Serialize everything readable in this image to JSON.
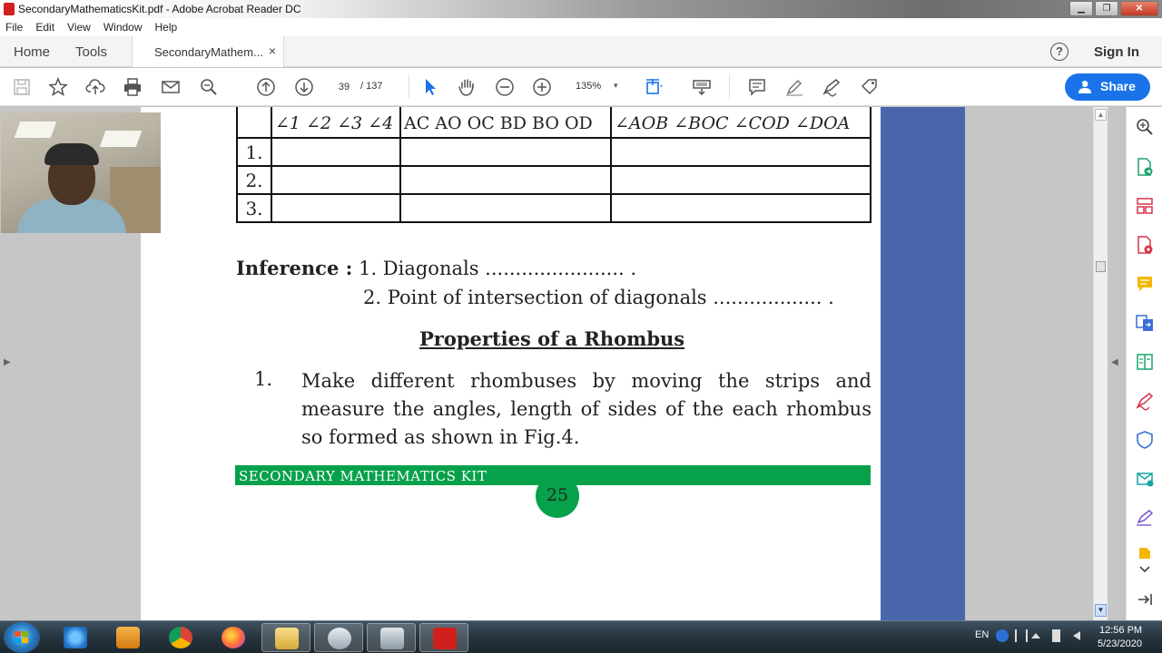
{
  "window": {
    "title": "SecondaryMathematicsKit.pdf - Adobe Acrobat Reader DC",
    "minimize": "▁",
    "maximize": "❐",
    "close": "✕"
  },
  "menu": [
    "File",
    "Edit",
    "View",
    "Window",
    "Help"
  ],
  "tabs": {
    "home": "Home",
    "tools": "Tools",
    "document": "SecondaryMathem...",
    "close": "×"
  },
  "header": {
    "help": "?",
    "sign_in": "Sign In"
  },
  "toolbar": {
    "page_current": "39",
    "page_total": "/ 137",
    "zoom": "135%",
    "zoom_caret": "▾",
    "share": "Share"
  },
  "pdf": {
    "table": {
      "header": {
        "angles": "∠1  ∠2  ∠3  ∠4",
        "lengths": "AC  AO  OC  BD BO  OD",
        "central_angles": "∠AOB  ∠BOC  ∠COD  ∠DOA"
      },
      "rows": [
        "1.",
        "2.",
        "3."
      ]
    },
    "inference_label": "Inference :",
    "inference_1": "1. Diagonals ....................... .",
    "inference_2": "2. Point of intersection of diagonals .................. .",
    "section_title": "Properties of a Rhombus",
    "list_number": "1.",
    "list_text": "Make different rhombuses by moving the strips and measure the angles, length of sides of the each rhombus so formed as shown in Fig.4.",
    "footer": "SECONDARY  MATHEMATICS  KIT",
    "page_number": "25"
  },
  "taskbar": {
    "lang": "EN",
    "time": "12:56 PM",
    "date": "5/23/2020"
  },
  "colors": {
    "accent": "#1a73e8",
    "footer_green": "#07a14b",
    "stripe_blue": "#4a66ad"
  }
}
